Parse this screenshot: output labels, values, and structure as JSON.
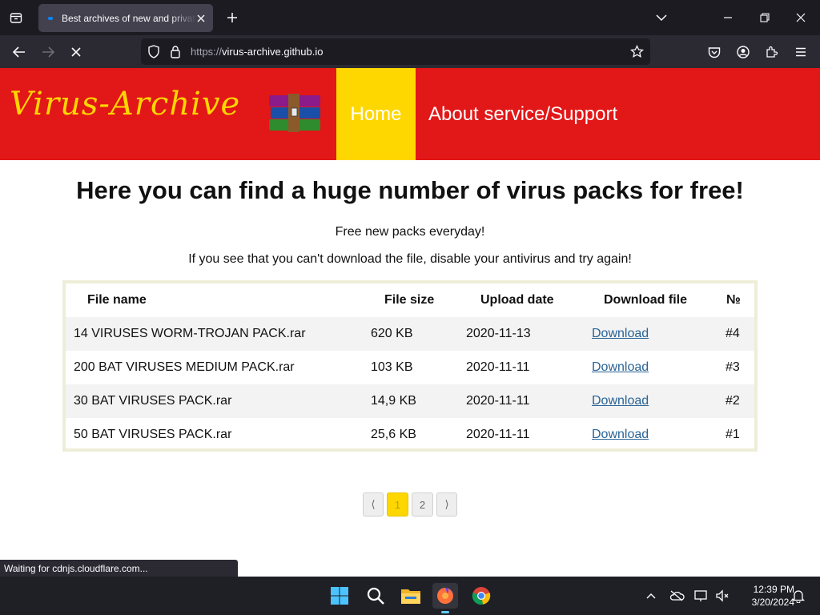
{
  "browser": {
    "tab": {
      "title": "Best archives of new and private viruses"
    },
    "url": {
      "scheme": "https://",
      "host": "virus-archive.github.io"
    }
  },
  "site": {
    "logo_text": "Virus-Archive",
    "nav": {
      "home": "Home",
      "about": "About service/Support"
    },
    "headline": "Here you can find a huge number of virus packs for free!",
    "subline1": "Free new packs everyday!",
    "subline2": "If you see that you can't download the file, disable your antivirus and try again!",
    "table": {
      "headers": {
        "name": "File name",
        "size": "File size",
        "date": "Upload date",
        "download": "Download file",
        "num": "№"
      },
      "rows": [
        {
          "name": "14 VIRUSES WORM-TROJAN PACK.rar",
          "size": "620 KB",
          "date": "2020-11-13",
          "link": "Download",
          "num": "#4"
        },
        {
          "name": "200 BAT VIRUSES MEDIUM PACK.rar",
          "size": "103 KB",
          "date": "2020-11-11",
          "link": "Download",
          "num": "#3"
        },
        {
          "name": "30 BAT VIRUSES PACK.rar",
          "size": "14,9 KB",
          "date": "2020-11-11",
          "link": "Download",
          "num": "#2"
        },
        {
          "name": "50 BAT VIRUSES PACK.rar",
          "size": "25,6 KB",
          "date": "2020-11-11",
          "link": "Download",
          "num": "#1"
        }
      ]
    },
    "pagination": {
      "prev": "⟨",
      "pages": [
        "1",
        "2"
      ],
      "active_page": "1",
      "next": "⟩"
    }
  },
  "status_text": "Waiting for cdnjs.cloudflare.com...",
  "taskbar": {
    "time": "12:39 PM",
    "date": "3/20/2024"
  },
  "colors": {
    "header_red": "#e21717",
    "accent_yellow": "#ffd700",
    "link_blue": "#2a6496"
  }
}
